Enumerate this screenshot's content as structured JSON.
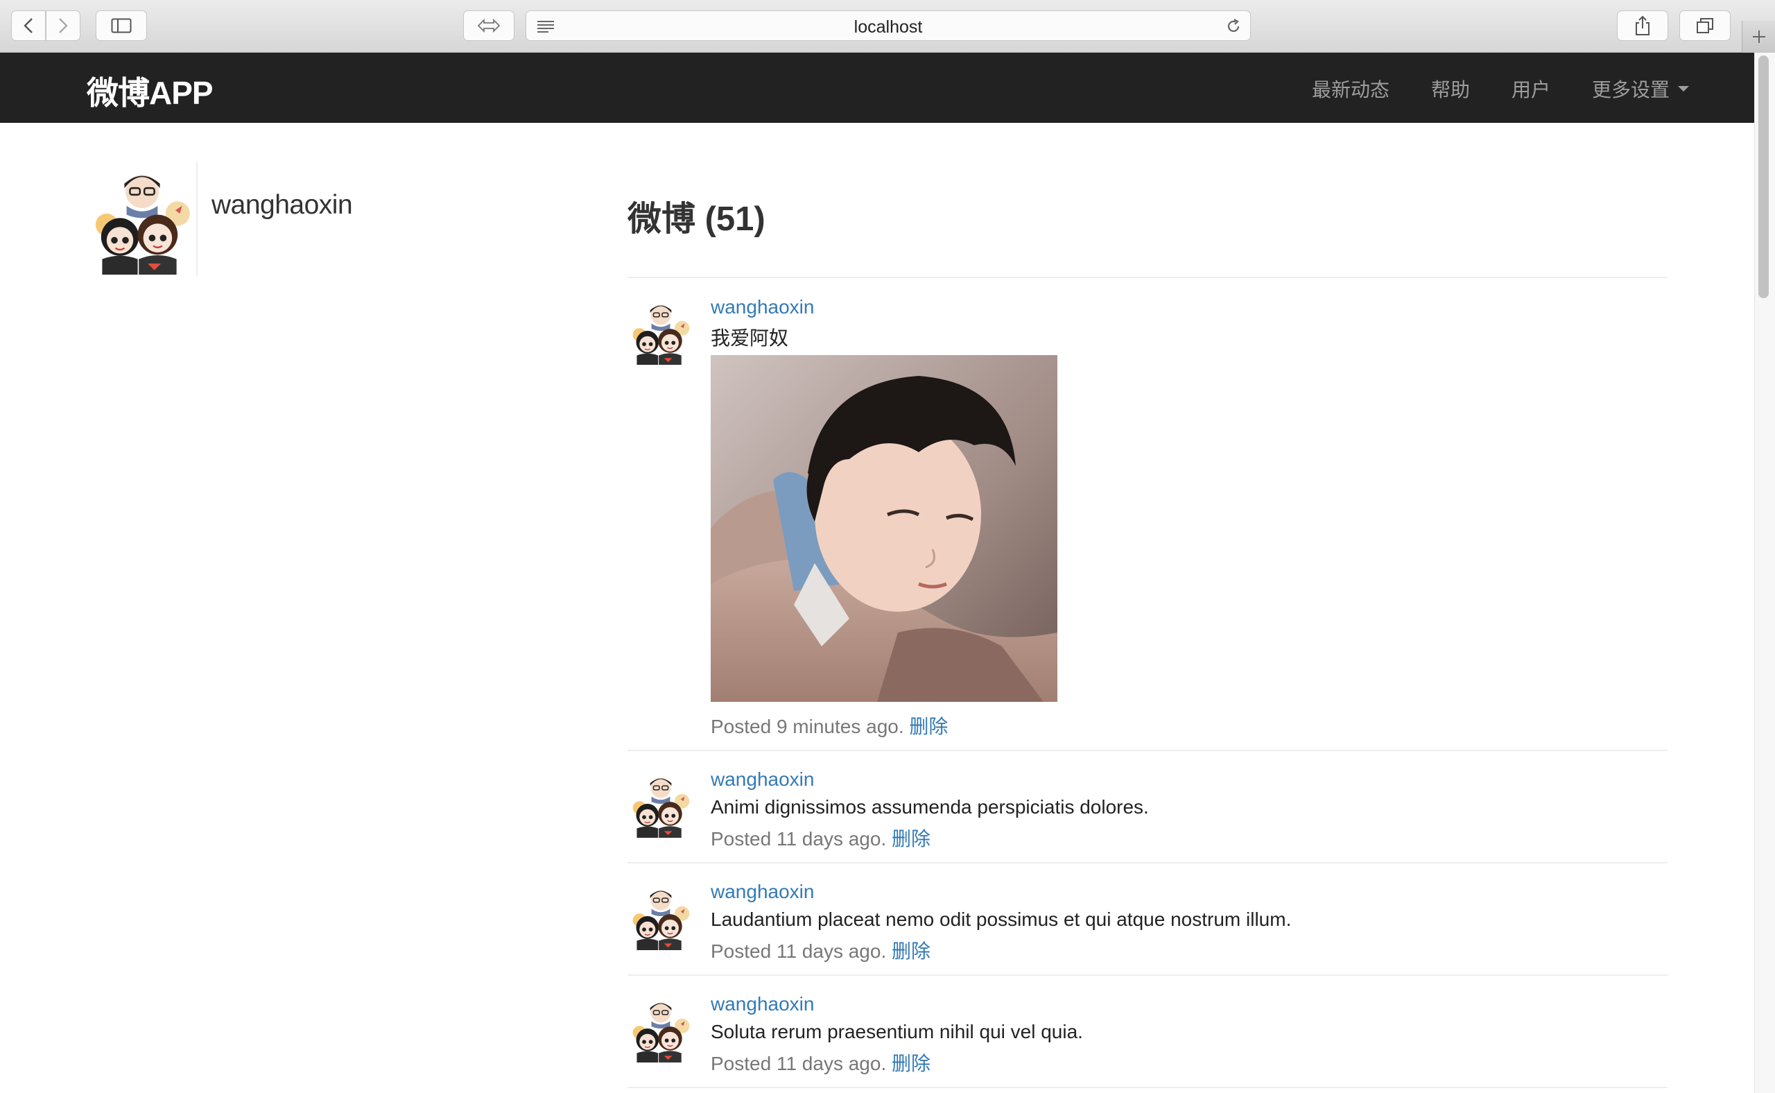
{
  "browser": {
    "url": "localhost",
    "icons": [
      "back-icon",
      "forward-icon",
      "sidebar-icon",
      "reader-icon",
      "list-icon",
      "reload-icon",
      "share-icon",
      "tabs-icon",
      "plus-icon"
    ]
  },
  "navbar": {
    "brand": "微博APP",
    "items": [
      {
        "label": "最新动态"
      },
      {
        "label": "帮助"
      },
      {
        "label": "用户"
      },
      {
        "label": "更多设置"
      }
    ]
  },
  "profile": {
    "username": "wanghaoxin"
  },
  "feed": {
    "title": "微博 (51)",
    "posts": [
      {
        "user": "wanghaoxin",
        "text": "我爱阿奴",
        "meta": "Posted 9 minutes ago.",
        "delete_label": "删除",
        "has_image": true
      },
      {
        "user": "wanghaoxin",
        "text": "Animi dignissimos assumenda perspiciatis dolores.",
        "meta": "Posted 11 days ago.",
        "delete_label": "删除"
      },
      {
        "user": "wanghaoxin",
        "text": "Laudantium placeat nemo odit possimus et qui atque nostrum illum.",
        "meta": "Posted 11 days ago.",
        "delete_label": "删除"
      },
      {
        "user": "wanghaoxin",
        "text": "Soluta rerum praesentium nihil qui vel quia.",
        "meta": "Posted 11 days ago.",
        "delete_label": "删除"
      }
    ]
  },
  "colors": {
    "navbar_bg": "#222222",
    "link": "#337ab7",
    "muted": "#777777",
    "divider": "#eeeeee"
  }
}
